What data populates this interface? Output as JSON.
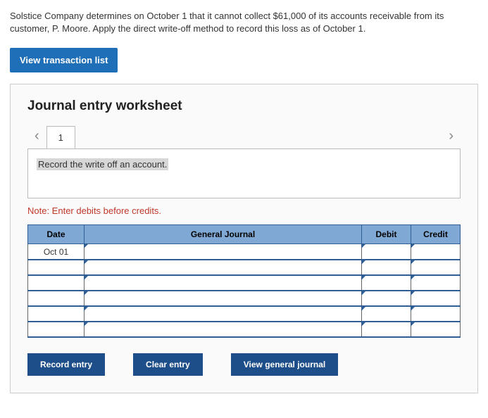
{
  "problem_text": "Solstice Company determines on October 1 that it cannot collect $61,000 of its accounts receivable from its customer, P. Moore. Apply the direct write-off method to record this loss as of October 1.",
  "view_transaction_list": "View transaction list",
  "worksheet": {
    "title": "Journal entry worksheet",
    "tab_label": "1",
    "instruction": "Record the write off an account.",
    "note": "Note: Enter debits before credits.",
    "headers": {
      "date": "Date",
      "general_journal": "General Journal",
      "debit": "Debit",
      "credit": "Credit"
    },
    "rows": [
      {
        "date": "Oct 01",
        "general_journal": "",
        "debit": "",
        "credit": ""
      },
      {
        "date": "",
        "general_journal": "",
        "debit": "",
        "credit": ""
      },
      {
        "date": "",
        "general_journal": "",
        "debit": "",
        "credit": ""
      },
      {
        "date": "",
        "general_journal": "",
        "debit": "",
        "credit": ""
      },
      {
        "date": "",
        "general_journal": "",
        "debit": "",
        "credit": ""
      },
      {
        "date": "",
        "general_journal": "",
        "debit": "",
        "credit": ""
      }
    ],
    "buttons": {
      "record": "Record entry",
      "clear": "Clear entry",
      "view_general_journal": "View general journal"
    }
  }
}
